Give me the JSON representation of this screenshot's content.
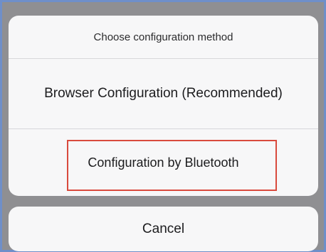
{
  "dialog": {
    "title": "Choose configuration method",
    "options": [
      {
        "label": "Browser Configuration (Recommended)"
      },
      {
        "label": "Configuration by Bluetooth"
      }
    ]
  },
  "cancel": {
    "label": "Cancel"
  },
  "colors": {
    "highlight": "#d94a3d",
    "backdrop": "#8f8f92",
    "frame_border": "#6f8fc9"
  }
}
